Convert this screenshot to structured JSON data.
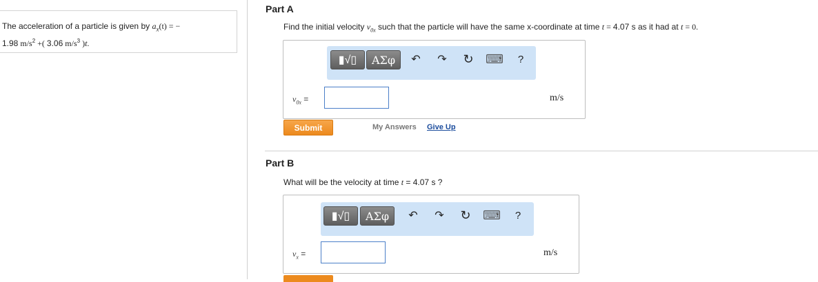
{
  "problem": {
    "line1_prefix": "The acceleration of a particle is given by ",
    "line1_func": "a",
    "line1_sub": "x",
    "line1_arg": "(t)",
    "line1_eq": " = −",
    "line2_val1": "1.98",
    "line2_unit1": " m/s",
    "line2_exp1": "2",
    "line2_plus": " +( ",
    "line2_val2": "3.06",
    "line2_unit2": " m/s",
    "line2_exp2": "3",
    "line2_end": " )",
    "line2_t": "t",
    "line2_dot": "."
  },
  "part_a": {
    "title": "Part A",
    "question_prefix": "Find the initial velocity ",
    "question_var": "v",
    "question_var_sub": "0x",
    "question_mid": " such that the particle will have the same x-coordinate at time ",
    "question_t1": "t",
    "question_eq1": " = ",
    "question_val": "4.07",
    "question_unit": " s as it had at ",
    "question_t2": "t",
    "question_eq2": " = 0.",
    "var_label": "v",
    "var_label_sub": "0x",
    "var_label_eq": " =",
    "unit": "m/s",
    "input_value": "",
    "submit_label": "Submit",
    "my_answers": "My Answers",
    "give_up": "Give Up"
  },
  "part_b": {
    "title": "Part B",
    "question_prefix": "What will be the velocity at time ",
    "question_t": "t",
    "question_rest": " = 4.07 s ?",
    "var_label": "v",
    "var_label_sub": "x",
    "var_label_eq": " =",
    "unit": "m/s",
    "input_value": ""
  },
  "toolbar": {
    "frac_label": "▮√▯",
    "greek_label": "ΑΣφ",
    "undo_icon": "↶",
    "redo_icon": "↷",
    "reset_icon": "↻",
    "keyboard_icon": "⌨",
    "help_label": "?"
  },
  "colors": {
    "toolbar_bg": "#cfe3f7",
    "submit_bg": "#ec8a1e",
    "link_blue": "#1a4b9c"
  }
}
